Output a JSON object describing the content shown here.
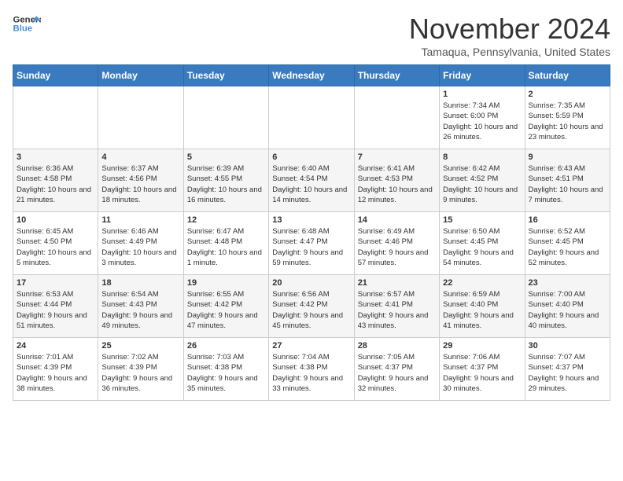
{
  "logo": {
    "line1": "General",
    "line2": "Blue"
  },
  "title": "November 2024",
  "location": "Tamaqua, Pennsylvania, United States",
  "weekdays": [
    "Sunday",
    "Monday",
    "Tuesday",
    "Wednesday",
    "Thursday",
    "Friday",
    "Saturday"
  ],
  "weeks": [
    [
      {
        "day": "",
        "info": ""
      },
      {
        "day": "",
        "info": ""
      },
      {
        "day": "",
        "info": ""
      },
      {
        "day": "",
        "info": ""
      },
      {
        "day": "",
        "info": ""
      },
      {
        "day": "1",
        "info": "Sunrise: 7:34 AM\nSunset: 6:00 PM\nDaylight: 10 hours and 26 minutes."
      },
      {
        "day": "2",
        "info": "Sunrise: 7:35 AM\nSunset: 5:59 PM\nDaylight: 10 hours and 23 minutes."
      }
    ],
    [
      {
        "day": "3",
        "info": "Sunrise: 6:36 AM\nSunset: 4:58 PM\nDaylight: 10 hours and 21 minutes."
      },
      {
        "day": "4",
        "info": "Sunrise: 6:37 AM\nSunset: 4:56 PM\nDaylight: 10 hours and 18 minutes."
      },
      {
        "day": "5",
        "info": "Sunrise: 6:39 AM\nSunset: 4:55 PM\nDaylight: 10 hours and 16 minutes."
      },
      {
        "day": "6",
        "info": "Sunrise: 6:40 AM\nSunset: 4:54 PM\nDaylight: 10 hours and 14 minutes."
      },
      {
        "day": "7",
        "info": "Sunrise: 6:41 AM\nSunset: 4:53 PM\nDaylight: 10 hours and 12 minutes."
      },
      {
        "day": "8",
        "info": "Sunrise: 6:42 AM\nSunset: 4:52 PM\nDaylight: 10 hours and 9 minutes."
      },
      {
        "day": "9",
        "info": "Sunrise: 6:43 AM\nSunset: 4:51 PM\nDaylight: 10 hours and 7 minutes."
      }
    ],
    [
      {
        "day": "10",
        "info": "Sunrise: 6:45 AM\nSunset: 4:50 PM\nDaylight: 10 hours and 5 minutes."
      },
      {
        "day": "11",
        "info": "Sunrise: 6:46 AM\nSunset: 4:49 PM\nDaylight: 10 hours and 3 minutes."
      },
      {
        "day": "12",
        "info": "Sunrise: 6:47 AM\nSunset: 4:48 PM\nDaylight: 10 hours and 1 minute."
      },
      {
        "day": "13",
        "info": "Sunrise: 6:48 AM\nSunset: 4:47 PM\nDaylight: 9 hours and 59 minutes."
      },
      {
        "day": "14",
        "info": "Sunrise: 6:49 AM\nSunset: 4:46 PM\nDaylight: 9 hours and 57 minutes."
      },
      {
        "day": "15",
        "info": "Sunrise: 6:50 AM\nSunset: 4:45 PM\nDaylight: 9 hours and 54 minutes."
      },
      {
        "day": "16",
        "info": "Sunrise: 6:52 AM\nSunset: 4:45 PM\nDaylight: 9 hours and 52 minutes."
      }
    ],
    [
      {
        "day": "17",
        "info": "Sunrise: 6:53 AM\nSunset: 4:44 PM\nDaylight: 9 hours and 51 minutes."
      },
      {
        "day": "18",
        "info": "Sunrise: 6:54 AM\nSunset: 4:43 PM\nDaylight: 9 hours and 49 minutes."
      },
      {
        "day": "19",
        "info": "Sunrise: 6:55 AM\nSunset: 4:42 PM\nDaylight: 9 hours and 47 minutes."
      },
      {
        "day": "20",
        "info": "Sunrise: 6:56 AM\nSunset: 4:42 PM\nDaylight: 9 hours and 45 minutes."
      },
      {
        "day": "21",
        "info": "Sunrise: 6:57 AM\nSunset: 4:41 PM\nDaylight: 9 hours and 43 minutes."
      },
      {
        "day": "22",
        "info": "Sunrise: 6:59 AM\nSunset: 4:40 PM\nDaylight: 9 hours and 41 minutes."
      },
      {
        "day": "23",
        "info": "Sunrise: 7:00 AM\nSunset: 4:40 PM\nDaylight: 9 hours and 40 minutes."
      }
    ],
    [
      {
        "day": "24",
        "info": "Sunrise: 7:01 AM\nSunset: 4:39 PM\nDaylight: 9 hours and 38 minutes."
      },
      {
        "day": "25",
        "info": "Sunrise: 7:02 AM\nSunset: 4:39 PM\nDaylight: 9 hours and 36 minutes."
      },
      {
        "day": "26",
        "info": "Sunrise: 7:03 AM\nSunset: 4:38 PM\nDaylight: 9 hours and 35 minutes."
      },
      {
        "day": "27",
        "info": "Sunrise: 7:04 AM\nSunset: 4:38 PM\nDaylight: 9 hours and 33 minutes."
      },
      {
        "day": "28",
        "info": "Sunrise: 7:05 AM\nSunset: 4:37 PM\nDaylight: 9 hours and 32 minutes."
      },
      {
        "day": "29",
        "info": "Sunrise: 7:06 AM\nSunset: 4:37 PM\nDaylight: 9 hours and 30 minutes."
      },
      {
        "day": "30",
        "info": "Sunrise: 7:07 AM\nSunset: 4:37 PM\nDaylight: 9 hours and 29 minutes."
      }
    ]
  ]
}
